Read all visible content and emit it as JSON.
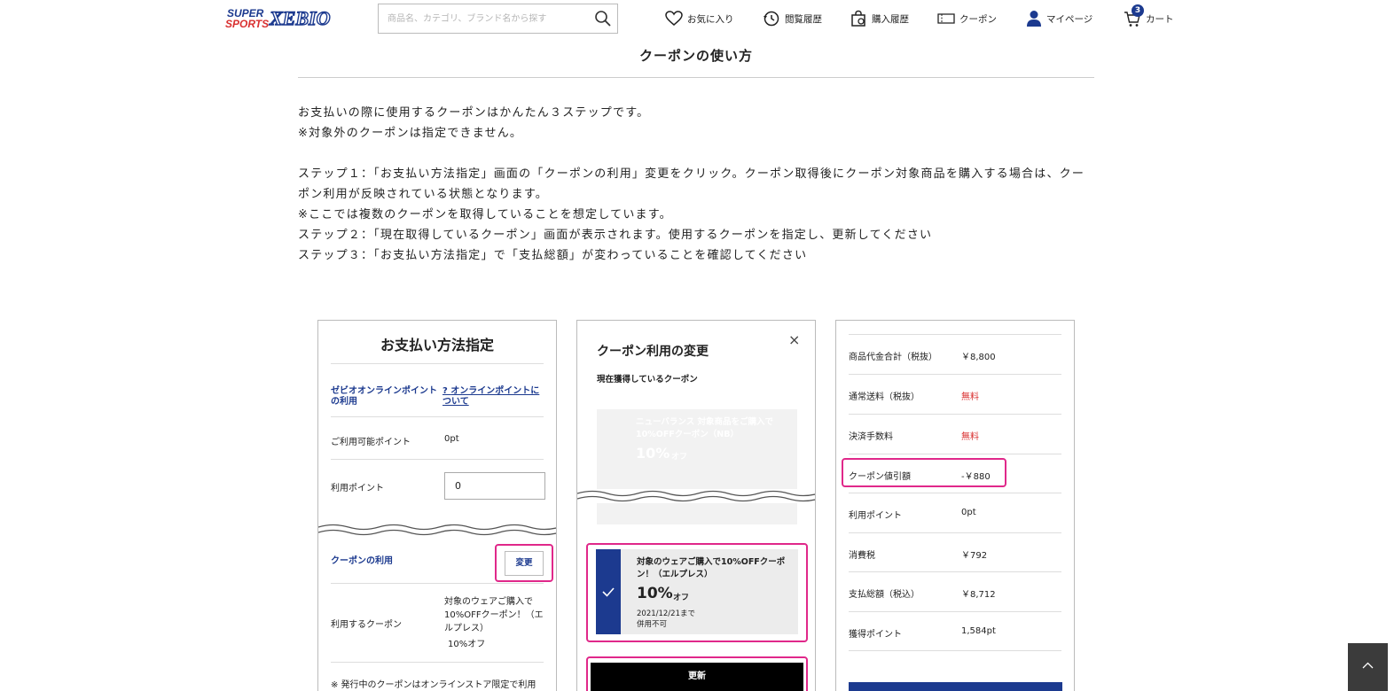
{
  "header": {
    "logo_text": "SUPER SPORTS XEBIO",
    "search_placeholder": "商品名、カテゴリ、ブランド名から探す",
    "nav": {
      "favorites": "お気に入り",
      "history": "閲覧履歴",
      "purchases": "購入履歴",
      "coupon": "クーポン",
      "mypage": "マイページ",
      "cart": "カート",
      "cart_count": "3"
    }
  },
  "page": {
    "title": "クーポンの使い方",
    "intro": [
      "お支払いの際に使用するクーポンはかんたん３ステップです。",
      "※対象外のクーポンは指定できません。",
      "",
      "ステップ１：「お支払い方法指定」画面の「クーポンの利用」変更をクリック。クーポン取得後にクーポン対象商品を購入する場合は、クーポン利用が反映されている状態となります。",
      "※ここでは複数のクーポンを取得していることを想定しています。",
      "ステップ２：「現在取得しているクーポン」画面が表示されます。使用するクーポンを指定し、更新してください",
      "ステップ３：「お支払い方法指定」で「支払総額」が変わっていることを確認してください"
    ]
  },
  "panel1": {
    "title": "お支払い方法指定",
    "points_label": "ゼビオオンラインポイントの利用",
    "points_help": "オンラインポイントについて",
    "available_label": "ご利用可能ポイント",
    "available_value": "0pt",
    "use_points_label": "利用ポイント",
    "use_points_value": "0",
    "coupon_use_label": "クーポンの利用",
    "change_button": "変更",
    "coupon_label": "利用するクーポン",
    "coupon_value": "対象のウェアご購入で10%OFFクーポン！（エルプレス）",
    "coupon_discount": "10%オフ",
    "note": "※ 発行中のクーポンはオンラインストア限定で利用"
  },
  "panel2": {
    "title": "クーポン利用の変更",
    "subtitle": "現在獲得しているクーポン",
    "faded_coupon_title": "ニューバランス 対象商品をご購入で10%OFFクーポン（NB）",
    "faded_coupon_discount": "10%",
    "faded_coupon_off": "オフ",
    "selected_coupon_title": "対象のウェアご購入で10%OFFクーポン！（エルプレス）",
    "selected_coupon_discount": "10%",
    "selected_coupon_off": "オフ",
    "selected_coupon_expiry": "2021/12/21まで",
    "selected_coupon_note": "併用不可",
    "update_button": "更新",
    "close": "×"
  },
  "panel3": {
    "rows": [
      {
        "label": "商品代金合計（税抜）",
        "value": "￥8,800"
      },
      {
        "label": "通常送料（税抜）",
        "value": "無料"
      },
      {
        "label": "決済手数料",
        "value": "無料"
      },
      {
        "label": "クーポン値引額",
        "value": "-￥880"
      },
      {
        "label": "利用ポイント",
        "value": "0pt"
      },
      {
        "label": "消費税",
        "value": "￥792"
      },
      {
        "label": "支払総額（税込）",
        "value": "￥8,712"
      },
      {
        "label": "獲得ポイント",
        "value": "1,584pt"
      }
    ]
  },
  "colors": {
    "brand_blue": "#1c3a8f",
    "highlight_pink": "#e0288a",
    "free_red": "#d93030"
  }
}
